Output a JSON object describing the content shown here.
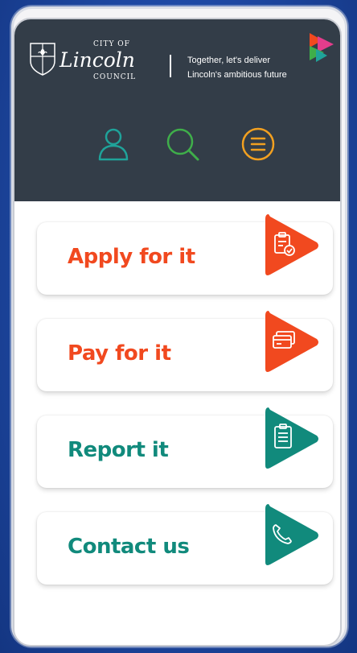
{
  "header": {
    "logo": {
      "city_of": "CITY OF",
      "lincoln": "Lincoln",
      "council": "COUNCIL"
    },
    "tagline_line1": "Together, let's deliver",
    "tagline_line2": "Lincoln's ambitious future",
    "icons": [
      {
        "name": "account-icon",
        "color": "#1fa39a"
      },
      {
        "name": "search-icon",
        "color": "#3fae4a"
      },
      {
        "name": "menu-icon",
        "color": "#f2a020"
      }
    ]
  },
  "actions": [
    {
      "label": "Apply for it",
      "color": "#f1491f",
      "icon": "clipboard-check-icon"
    },
    {
      "label": "Pay for it",
      "color": "#f1491f",
      "icon": "card-payment-icon"
    },
    {
      "label": "Report it",
      "color": "#118a7c",
      "icon": "clipboard-list-icon"
    },
    {
      "label": "Contact us",
      "color": "#118a7c",
      "icon": "phone-icon"
    }
  ]
}
